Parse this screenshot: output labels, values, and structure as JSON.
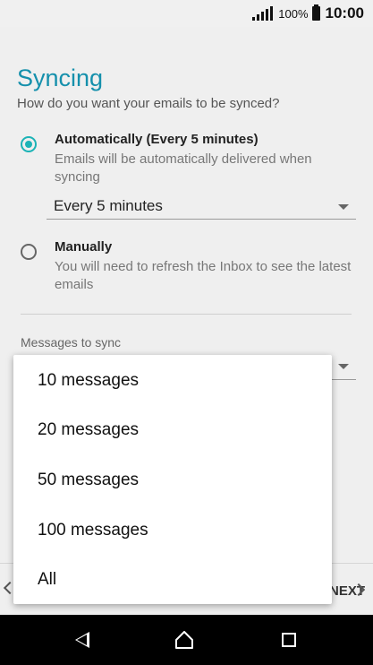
{
  "status_bar": {
    "battery_percent": "100%",
    "time": "10:00"
  },
  "page": {
    "title": "Syncing",
    "subtitle": "How do you want your emails to be synced?"
  },
  "options": [
    {
      "title": "Automatically (Every 5 minutes)",
      "description": "Emails will be automatically delivered when syncing",
      "selected": true
    },
    {
      "title": "Manually",
      "description": "You will need to refresh the Inbox to see the latest emails",
      "selected": false
    }
  ],
  "frequency_select": {
    "value": "Every 5 minutes"
  },
  "messages_to_sync": {
    "label": "Messages to sync"
  },
  "dropdown": {
    "items": [
      "10 messages",
      "20 messages",
      "50 messages",
      "100 messages",
      "All"
    ]
  },
  "bottom_bar": {
    "next_label": "NEXT"
  },
  "colors": {
    "accent": "#1cb3b6",
    "title": "#1590ac"
  }
}
